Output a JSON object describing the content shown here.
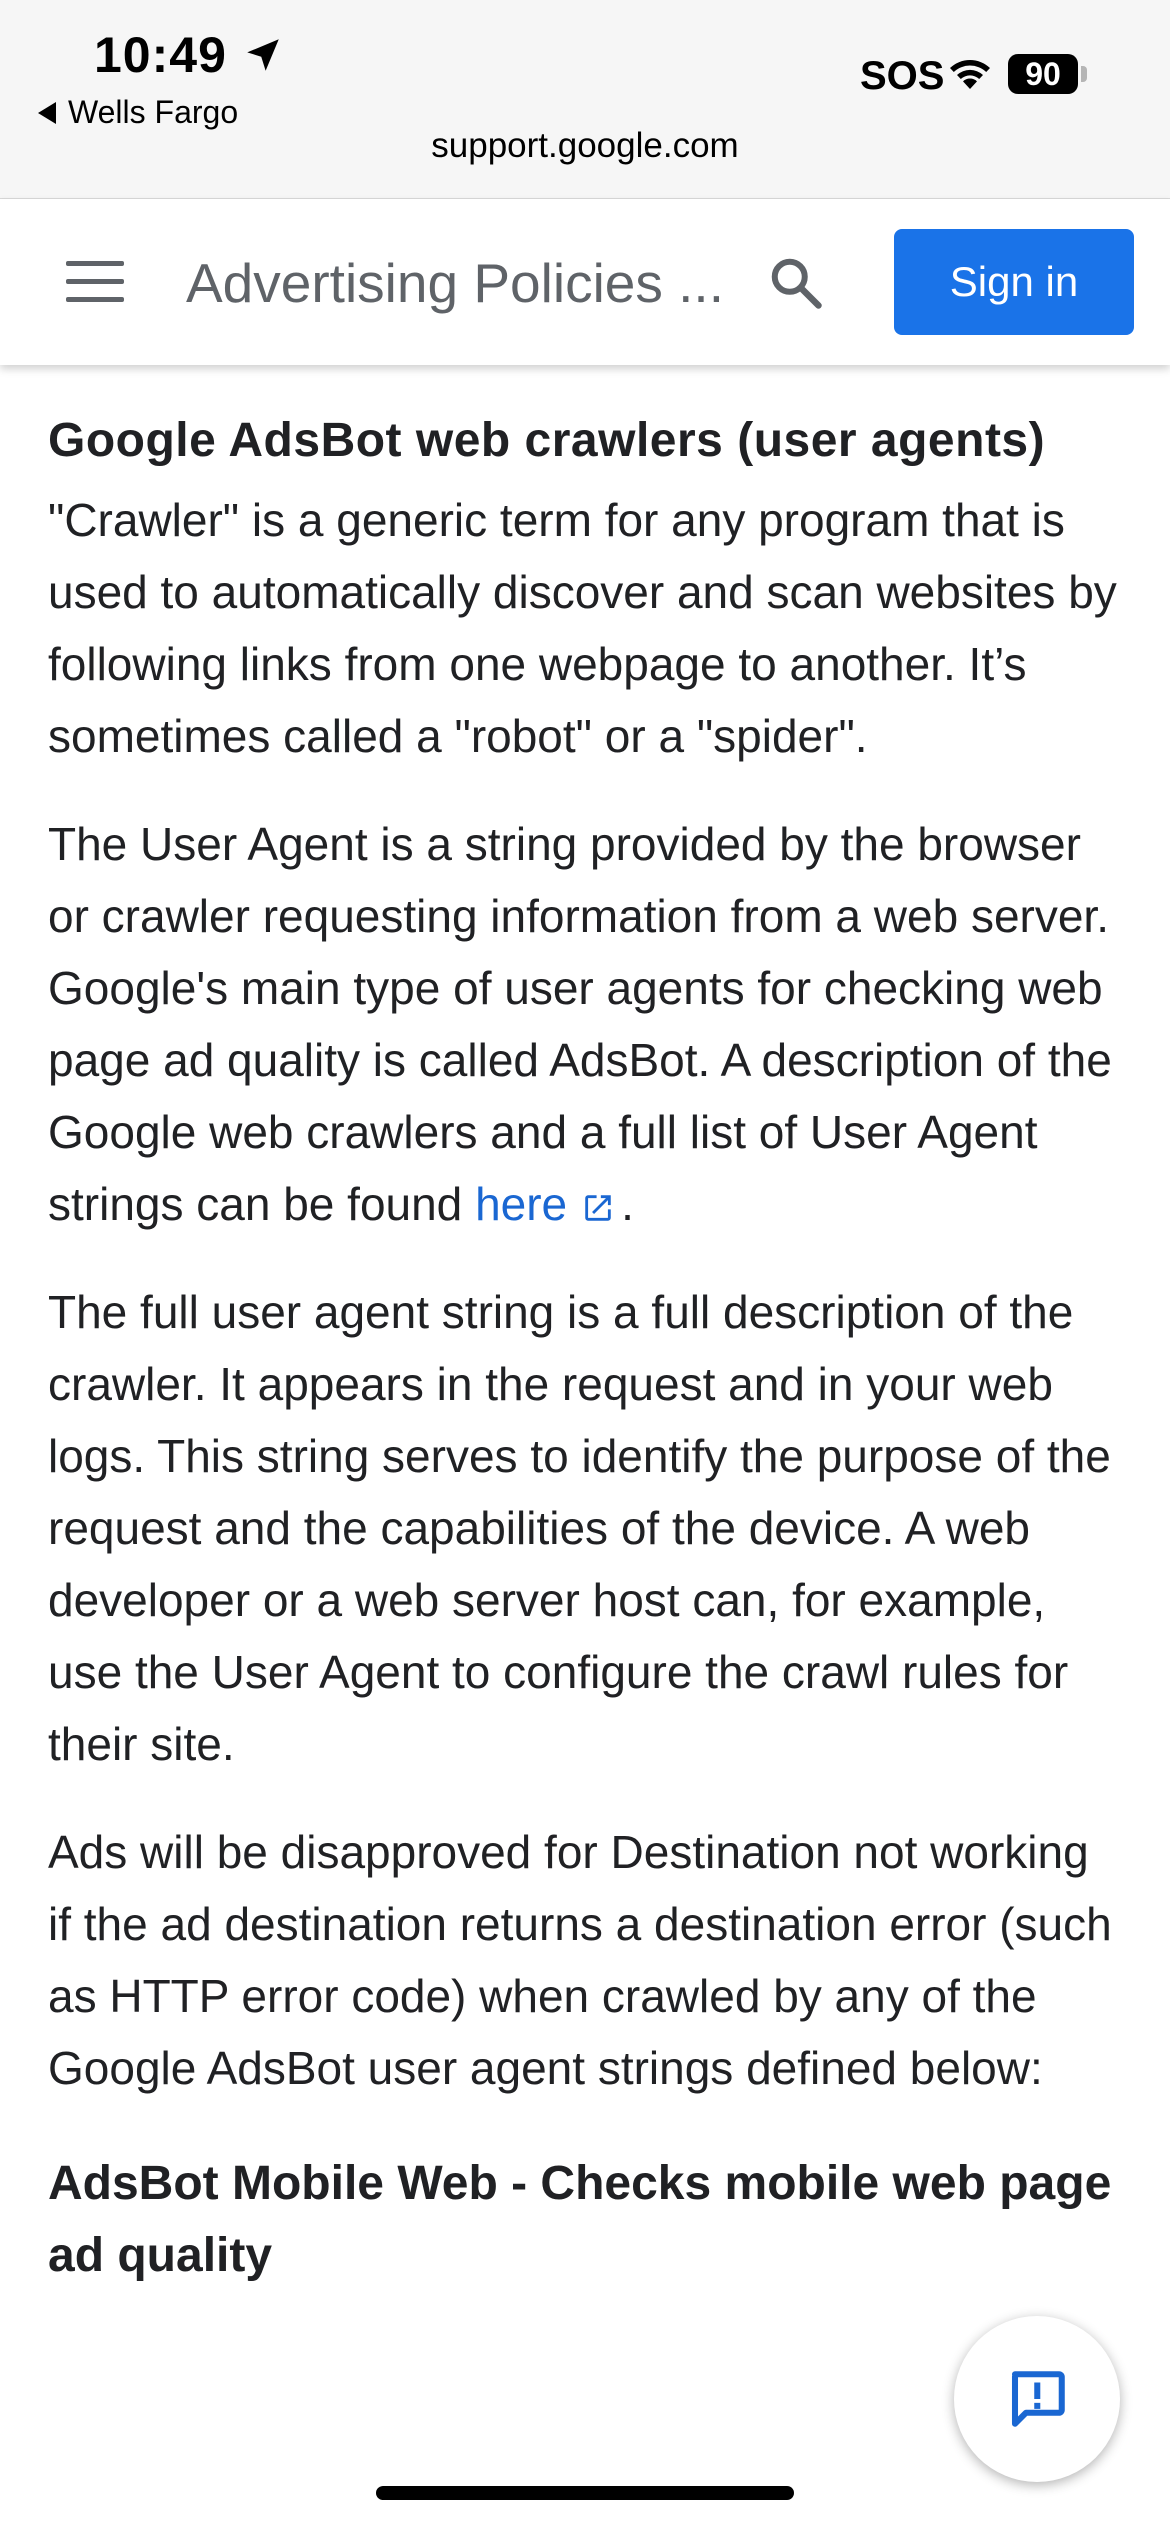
{
  "status_bar": {
    "time": "10:49",
    "back_app": "Wells Fargo",
    "sos": "SOS",
    "battery": "90",
    "url": "support.google.com"
  },
  "appbar": {
    "title": "Advertising Policies ...",
    "sign_in": "Sign in",
    "accent": "#1a73e8"
  },
  "content": {
    "heading": "Google AdsBot web crawlers (user agents)",
    "p1": "\"Crawler\" is a generic term for any program that is used to automatically discover and scan websites by following links from one webpage to another. It’s sometimes called a \"robot\" or a \"spider\".",
    "p2_before": "The User Agent is a string provided by the browser or crawler requesting information from a web server. Google's main type of user agents for checking web page ad quality is called AdsBot. A description of the Google web crawlers and a full list of User Agent strings can be found ",
    "p2_link": "here",
    "p2_after": ".",
    "p3": "The full user agent string is a full description of the crawler. It appears in the request and in your web logs. This string serves to identify the purpose of the request and the capabilities of the device. A web developer or a web server host can, for example, use the User Agent to configure the crawl rules for their site.",
    "p4": "Ads will be disapproved for Destination not working if the ad destination returns a destination error (such as HTTP error code) when crawled by any of the Google AdsBot user agent strings defined below:",
    "subheading": "AdsBot Mobile Web - Checks mobile web page ad quality"
  },
  "icons": {
    "menu": "hamburger-menu-icon",
    "search": "search-icon",
    "external_link": "external-link-icon",
    "feedback": "feedback-icon",
    "location": "location-arrow-icon",
    "wifi": "wifi-icon"
  }
}
